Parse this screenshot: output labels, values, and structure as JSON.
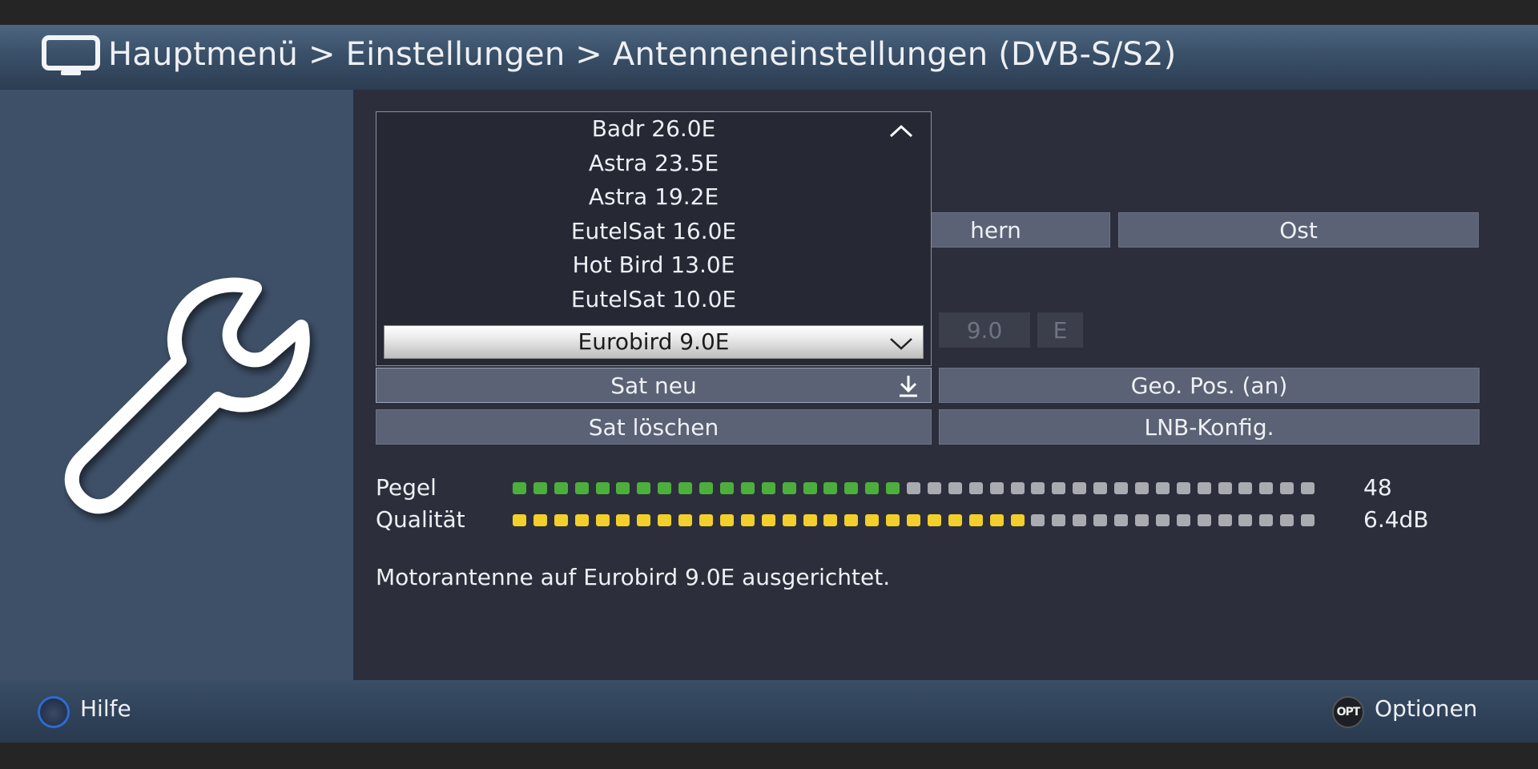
{
  "header": {
    "breadcrumb": "Hauptmenü > Einstellungen > Antenneneinstellungen (DVB-S/S2)"
  },
  "dropdown": {
    "items": [
      "Badr 26.0E",
      "Astra 23.5E",
      "Astra 19.2E",
      "EutelSat 16.0E",
      "Hot Bird 13.0E",
      "EutelSat 10.0E"
    ],
    "selected": "Eurobird 9.0E"
  },
  "behind": {
    "partial_button": "hern",
    "ost_button": "Ost",
    "position_value": "9.0",
    "direction_value": "E"
  },
  "buttons": {
    "sat_neu": "Sat neu",
    "geo_pos": "Geo. Pos. (an)",
    "sat_loeschen": "Sat löschen",
    "lnb_konfig": "LNB-Konfig."
  },
  "signal": {
    "pegel_label": "Pegel",
    "pegel_value": "48",
    "pegel_filled": 19,
    "qualitaet_label": "Qualität",
    "qualitaet_value": "6.4dB",
    "qualitaet_filled": 25,
    "total_segments": 39,
    "pegel_color": "#4caf3c",
    "qualitaet_color": "#f2cf2a",
    "empty_color": "#a9abb0"
  },
  "status": {
    "message": "Motorantenne auf Eurobird 9.0E ausgerichtet."
  },
  "footer": {
    "help_label": "Hilfe",
    "opt_icon": "OPT",
    "options_label": "Optionen"
  },
  "icons": {
    "header": "tv-icon",
    "sidebar": "wrench-icon"
  }
}
